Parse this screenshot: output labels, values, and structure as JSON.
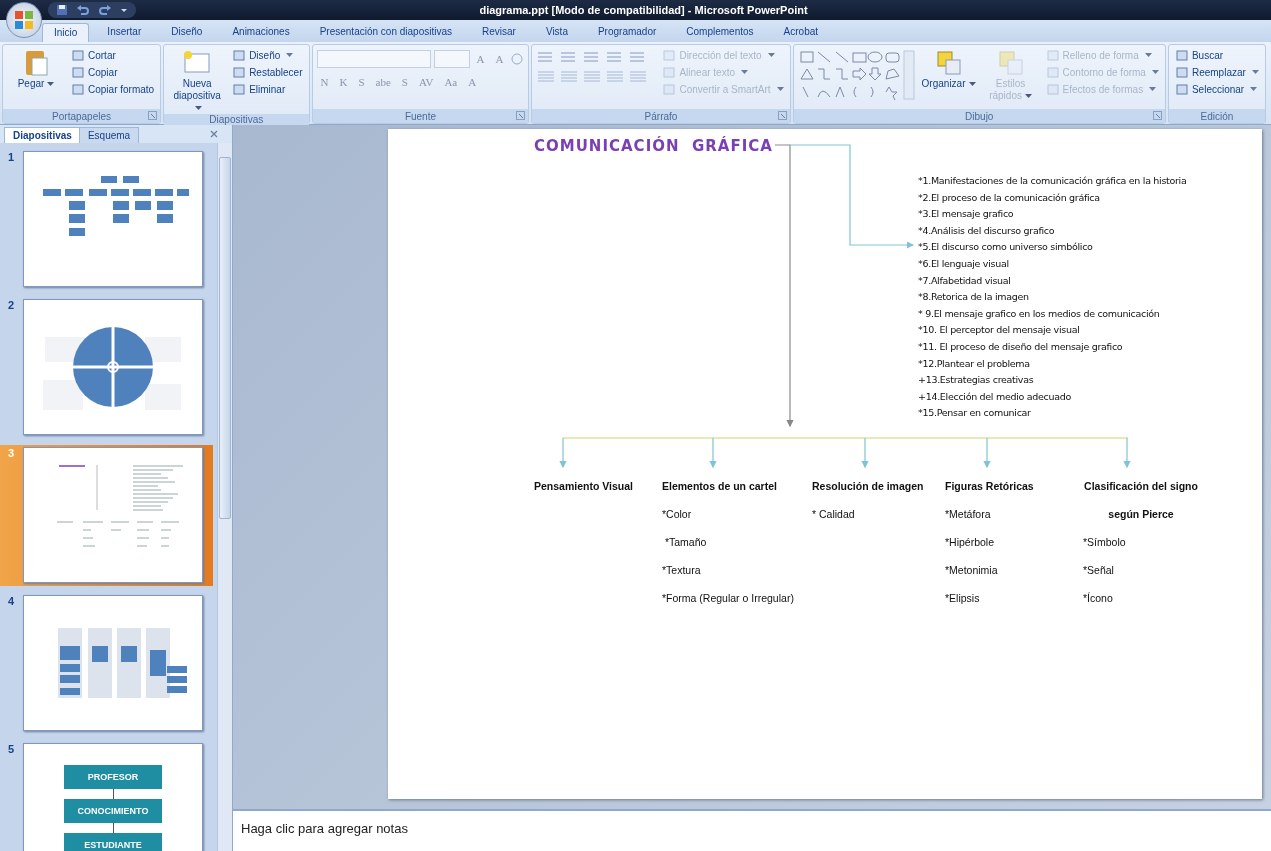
{
  "window": {
    "title": "diagrama.ppt [Modo de compatibilidad] - Microsoft PowerPoint"
  },
  "ribbon_tabs": [
    {
      "label": "Inicio",
      "selected": true
    },
    {
      "label": "Insertar",
      "selected": false
    },
    {
      "label": "Diseño",
      "selected": false
    },
    {
      "label": "Animaciones",
      "selected": false
    },
    {
      "label": "Presentación con diapositivas",
      "selected": false
    },
    {
      "label": "Revisar",
      "selected": false
    },
    {
      "label": "Vista",
      "selected": false
    },
    {
      "label": "Programador",
      "selected": false
    },
    {
      "label": "Complementos",
      "selected": false
    },
    {
      "label": "Acrobat",
      "selected": false
    }
  ],
  "ribbon_groups": [
    {
      "kind": "clipboard",
      "label": "Portapapeles",
      "launcher": true,
      "large": [
        {
          "label": "Pegar",
          "dropdown": true,
          "disabled": false
        }
      ],
      "small": [
        {
          "label": "Cortar",
          "dropdown": false,
          "disabled": false
        },
        {
          "label": "Copiar",
          "dropdown": false,
          "disabled": false
        },
        {
          "label": "Copiar formato",
          "dropdown": false,
          "disabled": false
        }
      ]
    },
    {
      "kind": "slides",
      "label": "Diapositivas",
      "launcher": false,
      "large": [
        {
          "label": "Nueva diapositiva",
          "dropdown": true,
          "disabled": false
        }
      ],
      "small": [
        {
          "label": "Diseño",
          "dropdown": true,
          "disabled": false
        },
        {
          "label": "Restablecer",
          "dropdown": false,
          "disabled": false
        },
        {
          "label": "Eliminar",
          "dropdown": false,
          "disabled": false
        }
      ]
    },
    {
      "kind": "font",
      "label": "Fuente",
      "launcher": true,
      "glyphs_top": [
        "A",
        "A"
      ],
      "glyphs_bottom": [
        "N",
        "K",
        "S",
        "abe",
        "S",
        "AV",
        "Aa",
        "A"
      ]
    },
    {
      "kind": "paragraph",
      "label": "Párrafo",
      "launcher": true,
      "small": [
        {
          "label": "Dirección del texto",
          "dropdown": true,
          "disabled": true
        },
        {
          "label": "Alinear texto",
          "dropdown": true,
          "disabled": true
        },
        {
          "label": "Convertir a SmartArt",
          "dropdown": true,
          "disabled": true
        }
      ]
    },
    {
      "kind": "drawing",
      "label": "Dibujo",
      "launcher": true,
      "large": [
        {
          "label": "Organizar",
          "dropdown": true,
          "disabled": false
        },
        {
          "label": "Estilos rápidos",
          "dropdown": true,
          "disabled": true
        }
      ],
      "small": [
        {
          "label": "Relleno de forma",
          "dropdown": true,
          "disabled": true
        },
        {
          "label": "Contorno de forma",
          "dropdown": true,
          "disabled": true
        },
        {
          "label": "Efectos de formas",
          "dropdown": true,
          "disabled": true
        }
      ]
    },
    {
      "kind": "editing",
      "label": "Edición",
      "launcher": false,
      "small": [
        {
          "label": "Buscar",
          "dropdown": false,
          "disabled": false
        },
        {
          "label": "Reemplazar",
          "dropdown": true,
          "disabled": false
        },
        {
          "label": "Seleccionar",
          "dropdown": true,
          "disabled": false
        }
      ]
    }
  ],
  "panel": {
    "tabs": [
      {
        "label": "Diapositivas",
        "selected": true
      },
      {
        "label": "Esquema",
        "selected": false
      }
    ],
    "thumbnails": [
      {
        "number": "1",
        "kind": "org-chart",
        "selected": false
      },
      {
        "number": "2",
        "kind": "circle",
        "selected": false
      },
      {
        "number": "3",
        "kind": "outline",
        "selected": true
      },
      {
        "number": "4",
        "kind": "columns",
        "selected": false
      },
      {
        "number": "5",
        "kind": "flow",
        "selected": false,
        "labels": [
          "PROFESOR",
          "CONOCIMIENTO",
          "ESTUDIANTE"
        ]
      }
    ]
  },
  "slide": {
    "title": "COMUNICACIÓN  GRÁFICA",
    "topics": [
      "*1.Manifestaciones de la comunicación gráfica en la historia",
      "*2.El proceso de la comunicación gráfica",
      "*3.El mensaje grafico",
      "*4.Análisis del discurso grafico",
      "*5.El discurso como universo simbólico",
      "*6.El lenguaje visual",
      "*7.Alfabetidad visual",
      "*8.Retorica de la imagen",
      "* 9.El mensaje grafico en los medios de comunicación",
      "*10. El perceptor del mensaje visual",
      "*11. El proceso de diseño del mensaje grafico",
      "*12.Plantear el problema",
      "+13.Estrategias creativas",
      "+14.Elección del medio adecuado",
      "*15.Pensar en comunicar"
    ],
    "columns": [
      {
        "heading": [
          "Pensamiento Visual"
        ]
      },
      {
        "heading": [
          "Elementos de un cartel"
        ],
        "items": [
          "*Color",
          " *Tamaño",
          "*Textura",
          "*Forma (Regular o Irregular)"
        ]
      },
      {
        "heading": [
          "Resolución de imagen"
        ],
        "items": [
          "* Calidad"
        ]
      },
      {
        "heading": [
          "Figuras Retóricas"
        ],
        "items": [
          "*Metáfora",
          "*Hipérbole",
          "*Metonimia",
          "*Elipsis"
        ]
      },
      {
        "heading": [
          "Clasificación del signo",
          "según Pierce"
        ],
        "items": [
          "*Símbolo",
          "*Señal",
          "*Ícono"
        ]
      }
    ]
  },
  "notes": {
    "placeholder": "Haga clic para agregar notas"
  }
}
